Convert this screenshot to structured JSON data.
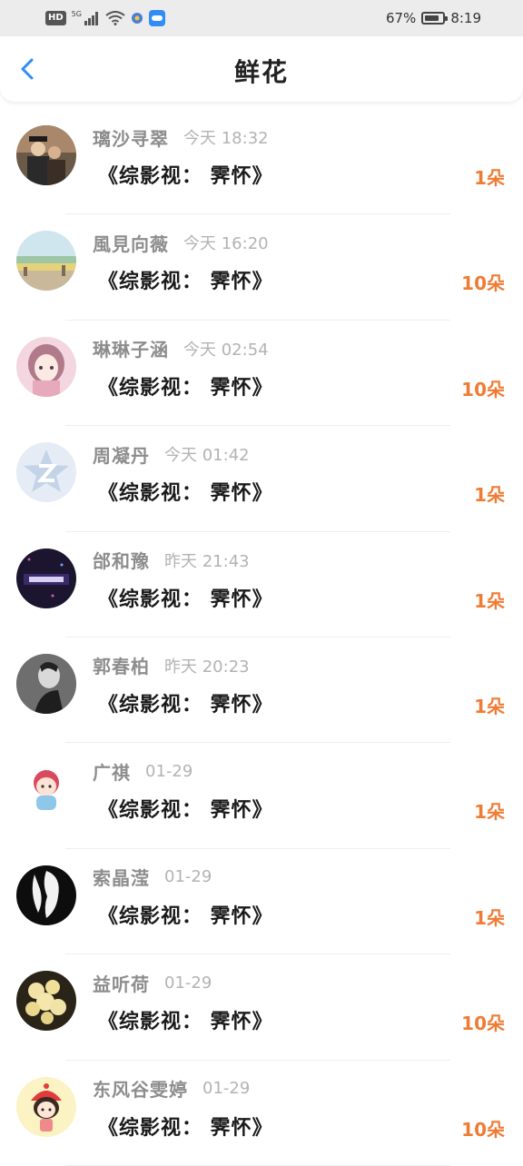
{
  "status_bar": {
    "hd": "HD",
    "network": "5G",
    "battery": "67%",
    "time": "8:19"
  },
  "header": {
    "back_icon": "chevron-left-icon",
    "title": "鲜花"
  },
  "items": [
    {
      "name": "璃沙寻翠",
      "time": "今天 18:32",
      "content": "《综影视： 霁怀》",
      "count": "1朵"
    },
    {
      "name": "風見向薇",
      "time": "今天 16:20",
      "content": "《综影视： 霁怀》",
      "count": "10朵"
    },
    {
      "name": "琳琳子涵",
      "time": "今天 02:54",
      "content": "《综影视： 霁怀》",
      "count": "10朵"
    },
    {
      "name": "周凝丹",
      "time": "今天 01:42",
      "content": "《综影视： 霁怀》",
      "count": "1朵"
    },
    {
      "name": "邰和豫",
      "time": "昨天 21:43",
      "content": "《综影视： 霁怀》",
      "count": "1朵"
    },
    {
      "name": "郭春柏",
      "time": "昨天 20:23",
      "content": "《综影视： 霁怀》",
      "count": "1朵"
    },
    {
      "name": "广祺",
      "time": "01-29",
      "content": "《综影视： 霁怀》",
      "count": "1朵"
    },
    {
      "name": "索晶滢",
      "time": "01-29",
      "content": "《综影视： 霁怀》",
      "count": "1朵"
    },
    {
      "name": "益听荷",
      "time": "01-29",
      "content": "《综影视： 霁怀》",
      "count": "10朵"
    },
    {
      "name": "东风谷雯婷",
      "time": "01-29",
      "content": "《综影视： 霁怀》",
      "count": "10朵"
    }
  ],
  "colors": {
    "accent": "#2f8df5",
    "count": "#ef7c35",
    "name": "#8d8d8d",
    "time": "#b3b3b3"
  }
}
